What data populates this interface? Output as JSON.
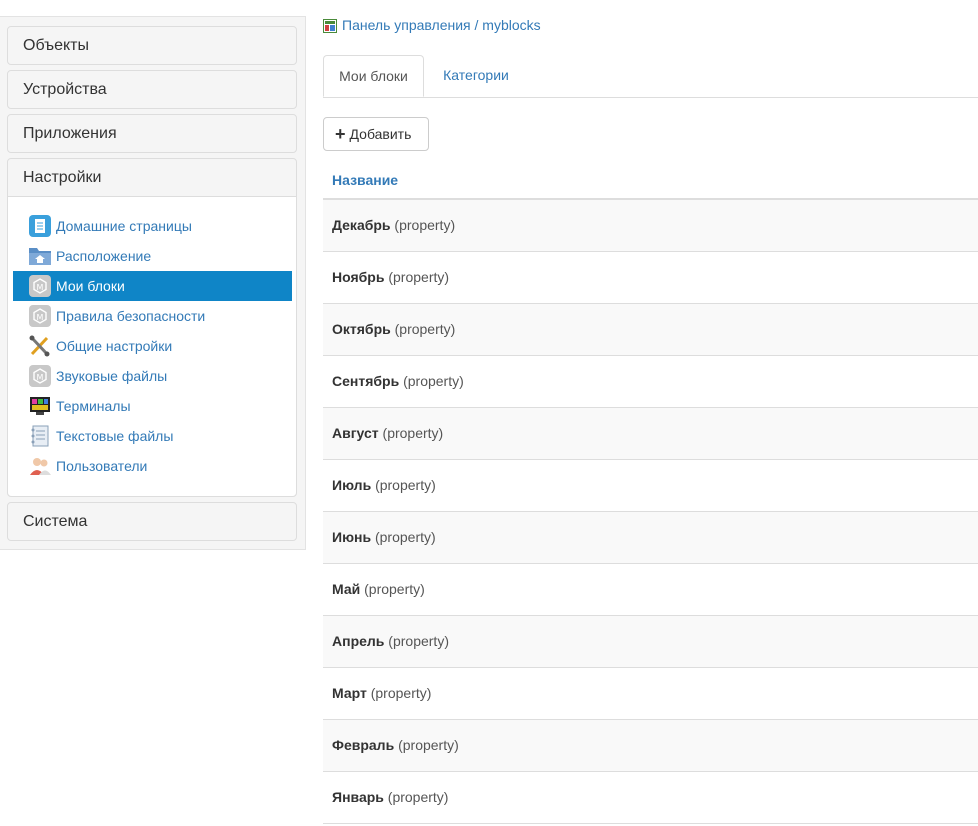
{
  "sidebar": {
    "panels": [
      {
        "label": "Объекты"
      },
      {
        "label": "Устройства"
      },
      {
        "label": "Приложения"
      },
      {
        "label": "Настройки"
      },
      {
        "label": "Система"
      }
    ],
    "settings_items": [
      {
        "label": "Домашние страницы",
        "icon": "home-pages-icon"
      },
      {
        "label": "Расположение",
        "icon": "location-folder-icon"
      },
      {
        "label": "Мои блоки",
        "icon": "my-blocks-icon",
        "active": true
      },
      {
        "label": "Правила безопасности",
        "icon": "security-rules-icon"
      },
      {
        "label": "Общие настройки",
        "icon": "tools-icon"
      },
      {
        "label": "Звуковые файлы",
        "icon": "sound-files-icon"
      },
      {
        "label": "Терминалы",
        "icon": "terminal-icon"
      },
      {
        "label": "Текстовые файлы",
        "icon": "text-files-icon"
      },
      {
        "label": "Пользователи",
        "icon": "users-icon"
      }
    ]
  },
  "breadcrumb": {
    "text": "Панель управления / myblocks",
    "icon": "breadcrumb-icon"
  },
  "tabs": [
    {
      "label": "Мои блоки",
      "active": true
    },
    {
      "label": "Категории",
      "active": false
    }
  ],
  "add_button": {
    "label": "Добавить"
  },
  "table": {
    "header": "Название",
    "rows": [
      {
        "name": "Декабрь",
        "type": "(property)"
      },
      {
        "name": "Ноябрь",
        "type": "(property)"
      },
      {
        "name": "Октябрь",
        "type": "(property)"
      },
      {
        "name": "Сентябрь",
        "type": "(property)"
      },
      {
        "name": "Август",
        "type": "(property)"
      },
      {
        "name": "Июль",
        "type": "(property)"
      },
      {
        "name": "Июнь",
        "type": "(property)"
      },
      {
        "name": "Май",
        "type": "(property)"
      },
      {
        "name": "Апрель",
        "type": "(property)"
      },
      {
        "name": "Март",
        "type": "(property)"
      },
      {
        "name": "Февраль",
        "type": "(property)"
      },
      {
        "name": "Январь",
        "type": "(property)"
      }
    ]
  },
  "colors": {
    "accent": "#337ab7",
    "active_item": "#0f85c7"
  }
}
